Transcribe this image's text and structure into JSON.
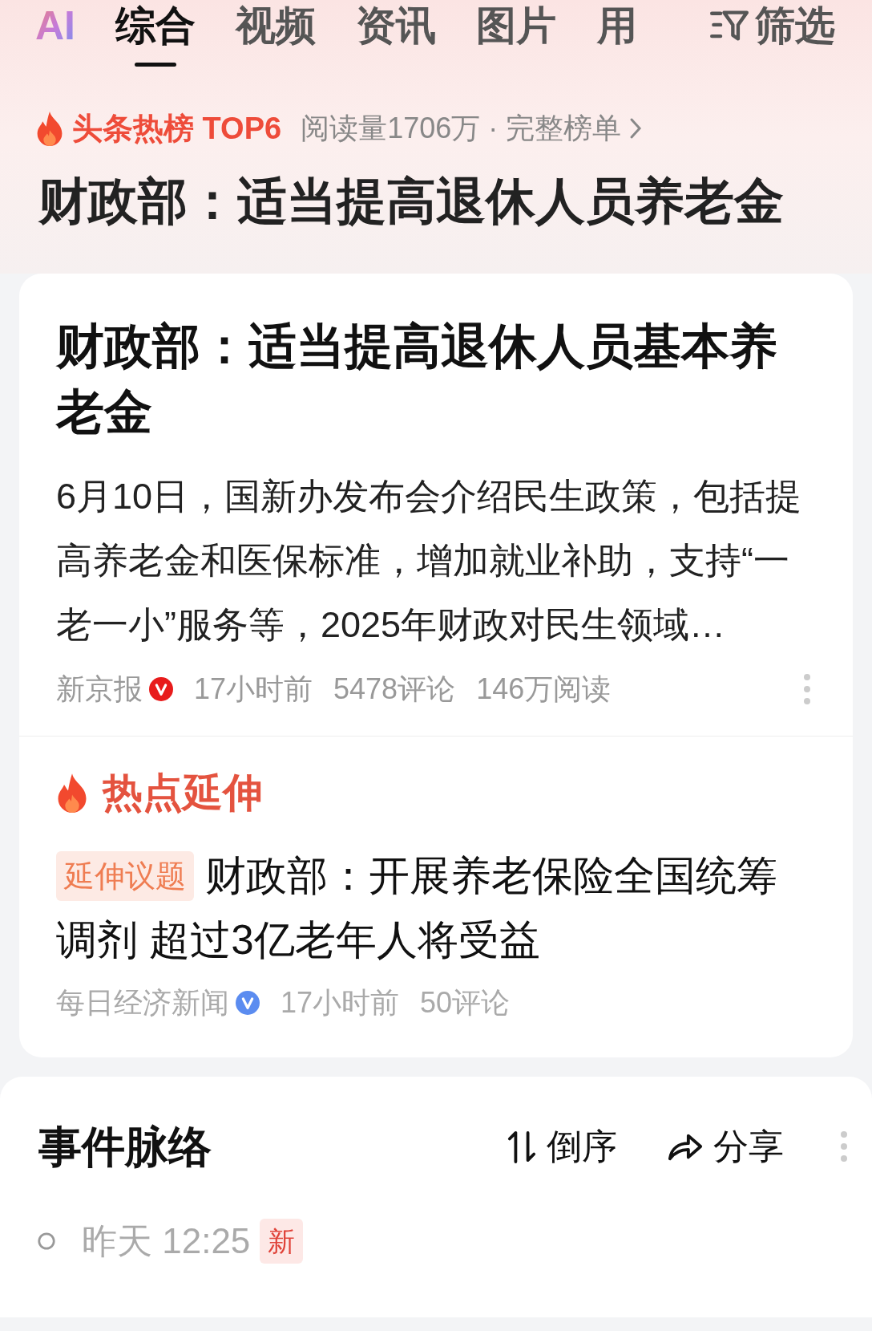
{
  "tabs": [
    {
      "label": "AI",
      "kind": "logo"
    },
    {
      "label": "综合",
      "kind": "text",
      "selected": true
    },
    {
      "label": "视频",
      "kind": "text",
      "selected": false
    },
    {
      "label": "资讯",
      "kind": "text",
      "selected": false
    },
    {
      "label": "图片",
      "kind": "text",
      "selected": false
    },
    {
      "label": "用",
      "kind": "text",
      "selected": false
    }
  ],
  "filter": {
    "label": "筛选"
  },
  "hot_list": {
    "title": "头条热榜 TOP6",
    "stats": "阅读量1706万 · 完整榜单",
    "headline": "财政部：适当提高退休人员养老金"
  },
  "article": {
    "title": "财政部：适当提高退休人员基本养老金",
    "summary": "6月10日，国新办发布会介绍民生政策，包括提高养老金和医保标准，增加就业补助，支持“一老一小”服务等，2025年财政对民生领域…",
    "source": "新京报",
    "time": "17小时前",
    "comments": "5478评论",
    "reads": "146万阅读"
  },
  "extension": {
    "heading": "热点延伸",
    "items": [
      {
        "tag": "延伸议题",
        "title": "财政部：开展养老保险全国统筹调剂 超过3亿老年人将受益",
        "source": "每日经济新闻",
        "time": "17小时前",
        "comments": "50评论"
      }
    ]
  },
  "timeline": {
    "title": "事件脉络",
    "sort": "倒序",
    "share": "分享",
    "entries": [
      {
        "time": "昨天 12:25",
        "badge": "新"
      }
    ]
  }
}
